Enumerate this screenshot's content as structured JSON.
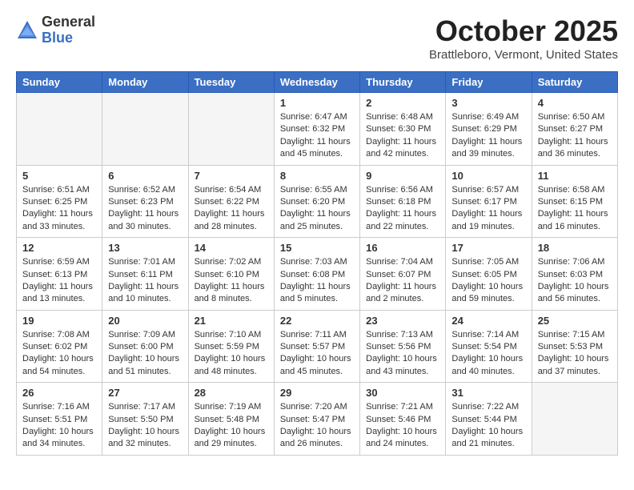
{
  "logo": {
    "general": "General",
    "blue": "Blue"
  },
  "title": "October 2025",
  "location": "Brattleboro, Vermont, United States",
  "days_of_week": [
    "Sunday",
    "Monday",
    "Tuesday",
    "Wednesday",
    "Thursday",
    "Friday",
    "Saturday"
  ],
  "weeks": [
    [
      {
        "day": "",
        "content": ""
      },
      {
        "day": "",
        "content": ""
      },
      {
        "day": "",
        "content": ""
      },
      {
        "day": "1",
        "content": "Sunrise: 6:47 AM\nSunset: 6:32 PM\nDaylight: 11 hours and 45 minutes."
      },
      {
        "day": "2",
        "content": "Sunrise: 6:48 AM\nSunset: 6:30 PM\nDaylight: 11 hours and 42 minutes."
      },
      {
        "day": "3",
        "content": "Sunrise: 6:49 AM\nSunset: 6:29 PM\nDaylight: 11 hours and 39 minutes."
      },
      {
        "day": "4",
        "content": "Sunrise: 6:50 AM\nSunset: 6:27 PM\nDaylight: 11 hours and 36 minutes."
      }
    ],
    [
      {
        "day": "5",
        "content": "Sunrise: 6:51 AM\nSunset: 6:25 PM\nDaylight: 11 hours and 33 minutes."
      },
      {
        "day": "6",
        "content": "Sunrise: 6:52 AM\nSunset: 6:23 PM\nDaylight: 11 hours and 30 minutes."
      },
      {
        "day": "7",
        "content": "Sunrise: 6:54 AM\nSunset: 6:22 PM\nDaylight: 11 hours and 28 minutes."
      },
      {
        "day": "8",
        "content": "Sunrise: 6:55 AM\nSunset: 6:20 PM\nDaylight: 11 hours and 25 minutes."
      },
      {
        "day": "9",
        "content": "Sunrise: 6:56 AM\nSunset: 6:18 PM\nDaylight: 11 hours and 22 minutes."
      },
      {
        "day": "10",
        "content": "Sunrise: 6:57 AM\nSunset: 6:17 PM\nDaylight: 11 hours and 19 minutes."
      },
      {
        "day": "11",
        "content": "Sunrise: 6:58 AM\nSunset: 6:15 PM\nDaylight: 11 hours and 16 minutes."
      }
    ],
    [
      {
        "day": "12",
        "content": "Sunrise: 6:59 AM\nSunset: 6:13 PM\nDaylight: 11 hours and 13 minutes."
      },
      {
        "day": "13",
        "content": "Sunrise: 7:01 AM\nSunset: 6:11 PM\nDaylight: 11 hours and 10 minutes."
      },
      {
        "day": "14",
        "content": "Sunrise: 7:02 AM\nSunset: 6:10 PM\nDaylight: 11 hours and 8 minutes."
      },
      {
        "day": "15",
        "content": "Sunrise: 7:03 AM\nSunset: 6:08 PM\nDaylight: 11 hours and 5 minutes."
      },
      {
        "day": "16",
        "content": "Sunrise: 7:04 AM\nSunset: 6:07 PM\nDaylight: 11 hours and 2 minutes."
      },
      {
        "day": "17",
        "content": "Sunrise: 7:05 AM\nSunset: 6:05 PM\nDaylight: 10 hours and 59 minutes."
      },
      {
        "day": "18",
        "content": "Sunrise: 7:06 AM\nSunset: 6:03 PM\nDaylight: 10 hours and 56 minutes."
      }
    ],
    [
      {
        "day": "19",
        "content": "Sunrise: 7:08 AM\nSunset: 6:02 PM\nDaylight: 10 hours and 54 minutes."
      },
      {
        "day": "20",
        "content": "Sunrise: 7:09 AM\nSunset: 6:00 PM\nDaylight: 10 hours and 51 minutes."
      },
      {
        "day": "21",
        "content": "Sunrise: 7:10 AM\nSunset: 5:59 PM\nDaylight: 10 hours and 48 minutes."
      },
      {
        "day": "22",
        "content": "Sunrise: 7:11 AM\nSunset: 5:57 PM\nDaylight: 10 hours and 45 minutes."
      },
      {
        "day": "23",
        "content": "Sunrise: 7:13 AM\nSunset: 5:56 PM\nDaylight: 10 hours and 43 minutes."
      },
      {
        "day": "24",
        "content": "Sunrise: 7:14 AM\nSunset: 5:54 PM\nDaylight: 10 hours and 40 minutes."
      },
      {
        "day": "25",
        "content": "Sunrise: 7:15 AM\nSunset: 5:53 PM\nDaylight: 10 hours and 37 minutes."
      }
    ],
    [
      {
        "day": "26",
        "content": "Sunrise: 7:16 AM\nSunset: 5:51 PM\nDaylight: 10 hours and 34 minutes."
      },
      {
        "day": "27",
        "content": "Sunrise: 7:17 AM\nSunset: 5:50 PM\nDaylight: 10 hours and 32 minutes."
      },
      {
        "day": "28",
        "content": "Sunrise: 7:19 AM\nSunset: 5:48 PM\nDaylight: 10 hours and 29 minutes."
      },
      {
        "day": "29",
        "content": "Sunrise: 7:20 AM\nSunset: 5:47 PM\nDaylight: 10 hours and 26 minutes."
      },
      {
        "day": "30",
        "content": "Sunrise: 7:21 AM\nSunset: 5:46 PM\nDaylight: 10 hours and 24 minutes."
      },
      {
        "day": "31",
        "content": "Sunrise: 7:22 AM\nSunset: 5:44 PM\nDaylight: 10 hours and 21 minutes."
      },
      {
        "day": "",
        "content": ""
      }
    ]
  ]
}
